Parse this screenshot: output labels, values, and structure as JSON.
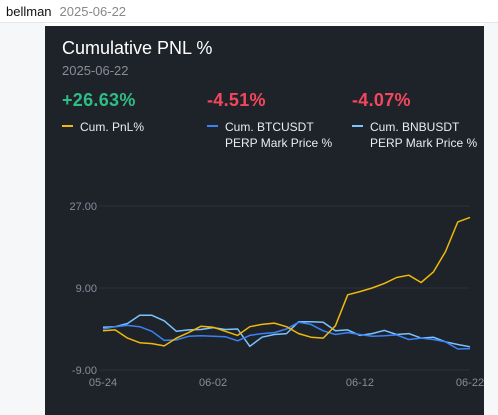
{
  "header": {
    "username": "bellman",
    "date": "2025-06-22"
  },
  "card": {
    "title": "Cumulative PNL %",
    "date": "2025-06-22"
  },
  "stats": [
    {
      "value": "+26.63%",
      "legend": "Cum. PnL%",
      "color": "#f0b90b",
      "trend": "positive"
    },
    {
      "value": "-4.51%",
      "legend": "Cum. BTCUSDT PERP Mark Price %",
      "color": "#3b82f6",
      "trend": "negative"
    },
    {
      "value": "-4.07%",
      "legend": "Cum. BNBUSDT PERP Mark Price %",
      "color": "#7cc3ff",
      "trend": "negative"
    }
  ],
  "chart_data": {
    "type": "line",
    "title": "Cumulative PNL %",
    "subtitle": "2025-06-22",
    "ylim": [
      -9,
      27
    ],
    "y_ticks": [
      27,
      9,
      -9
    ],
    "y_tick_labels": [
      "27.00",
      "9.00",
      "-9.00"
    ],
    "x_ticks": [
      0,
      9,
      21,
      30
    ],
    "x_tick_labels": [
      "05-24",
      "06-02",
      "06-12",
      "06-22"
    ],
    "grid": true,
    "series": [
      {
        "name": "Cum. PnL%",
        "color": "#f0b90b",
        "values": [
          -0.4,
          -0.2,
          -2.0,
          -3.0,
          -3.2,
          -3.7,
          -2.0,
          -0.8,
          0.6,
          0.4,
          -0.5,
          -1.4,
          0.5,
          1.0,
          1.3,
          0.5,
          -1.0,
          -1.8,
          -2.0,
          0.7,
          7.5,
          8.2,
          9.0,
          10.0,
          11.3,
          11.8,
          10.2,
          12.5,
          17.0,
          23.5,
          24.5
        ]
      },
      {
        "name": "Cum. BTCUSDT PERP Mark Price %",
        "color": "#3b82f6",
        "values": [
          0.0,
          0.5,
          0.8,
          0.5,
          -0.5,
          -2.5,
          -2.4,
          -1.6,
          -1.5,
          -1.6,
          -1.7,
          -2.6,
          -1.4,
          -1.0,
          -0.8,
          0.0,
          1.5,
          1.0,
          -0.4,
          -1.2,
          -0.8,
          -1.2,
          -1.6,
          -1.5,
          -1.3,
          -2.3,
          -2.0,
          -2.3,
          -2.8,
          -4.4,
          -4.3
        ]
      },
      {
        "name": "Cum. BNBUSDT PERP Mark Price %",
        "color": "#7cc3ff",
        "values": [
          0.4,
          0.5,
          1.2,
          3.0,
          3.0,
          1.8,
          -0.5,
          -0.2,
          -0.1,
          0.3,
          -0.1,
          0.0,
          -3.8,
          -1.8,
          -1.2,
          -1.0,
          1.6,
          1.6,
          1.5,
          -0.4,
          -0.2,
          -1.4,
          -1.0,
          -0.3,
          -1.2,
          -1.0,
          -2.0,
          -1.8,
          -2.8,
          -3.4,
          -3.9
        ]
      }
    ]
  }
}
